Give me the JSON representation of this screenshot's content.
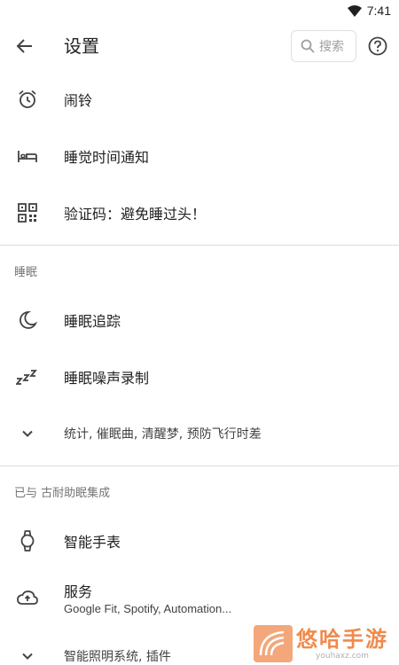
{
  "status_bar": {
    "time": "7:41",
    "wifi_icon": "wifi-icon"
  },
  "app_bar": {
    "title": "设置",
    "search_placeholder": "搜索",
    "back_icon": "arrow-back-icon",
    "help_icon": "help-icon"
  },
  "items_top": [
    {
      "label": "闹铃",
      "icon": "alarm-clock-icon"
    },
    {
      "label": "睡觉时间通知",
      "icon": "bed-icon"
    },
    {
      "label": "验证码：避免睡过头！",
      "icon": "qr-code-icon"
    }
  ],
  "sleep_section": {
    "header": "睡眠",
    "items": [
      {
        "label": "睡眠追踪",
        "icon": "moon-icon"
      },
      {
        "label": "睡眠噪声录制",
        "icon": "zzz-icon"
      },
      {
        "label": "统计, 催眠曲, 清醒梦, 预防飞行时差",
        "icon": "chevron-down-icon"
      }
    ]
  },
  "integration_section": {
    "header": "已与 古耐助眠集成",
    "items": [
      {
        "label": "智能手表",
        "icon": "smartwatch-icon"
      },
      {
        "label": "服务",
        "sub": "Google Fit, Spotify, Automation...",
        "icon": "cloud-upload-icon"
      },
      {
        "label": "智能照明系统, 插件",
        "icon": "chevron-down-icon"
      }
    ]
  },
  "watermark": {
    "title": "悠哈手游",
    "url": "youhaxz.com"
  }
}
